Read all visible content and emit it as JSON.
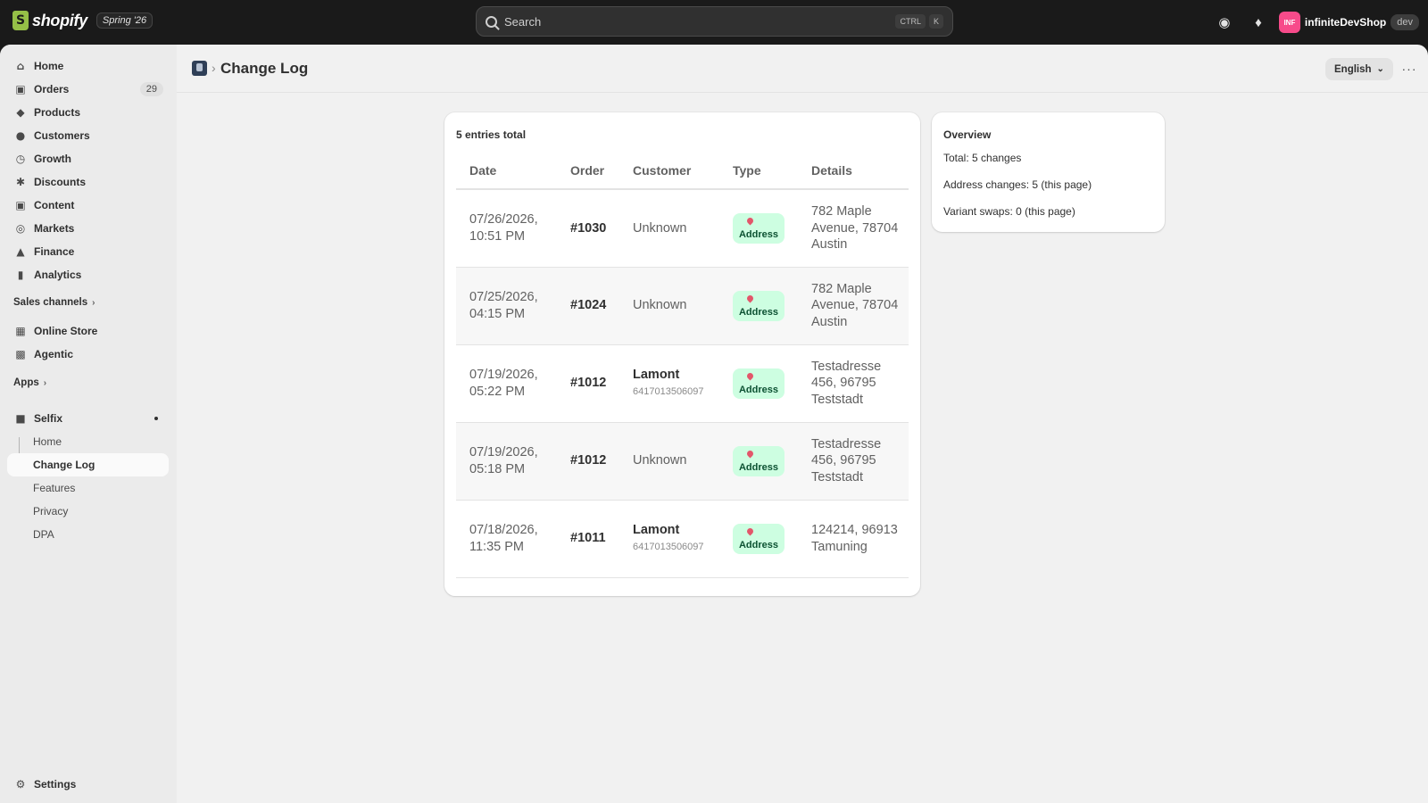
{
  "topbar": {
    "brand": "shopify",
    "tag": "Spring '26",
    "search_placeholder": "Search",
    "shortcut_keys": [
      "CTRL",
      "K"
    ],
    "shop_initials": "INF",
    "shop_name": "infiniteDevShop",
    "shop_badge": "dev"
  },
  "sidebar": {
    "main": [
      {
        "label": "Home",
        "icon": "home-icon"
      },
      {
        "label": "Orders",
        "icon": "orders-icon",
        "badge": "29"
      },
      {
        "label": "Products",
        "icon": "tag-icon"
      },
      {
        "label": "Customers",
        "icon": "person-icon"
      },
      {
        "label": "Growth",
        "icon": "gauge-icon"
      },
      {
        "label": "Discounts",
        "icon": "discount-icon"
      },
      {
        "label": "Content",
        "icon": "monitor-icon"
      },
      {
        "label": "Markets",
        "icon": "globe-icon"
      },
      {
        "label": "Finance",
        "icon": "bank-icon"
      },
      {
        "label": "Analytics",
        "icon": "bar-chart-icon"
      }
    ],
    "sales_channels_label": "Sales channels",
    "channels": [
      {
        "label": "Online Store",
        "icon": "store-icon"
      },
      {
        "label": "Agentic",
        "icon": "agent-icon"
      }
    ],
    "apps_label": "Apps",
    "app_name": "Selfix",
    "app_sub": [
      {
        "label": "Home"
      },
      {
        "label": "Change Log"
      },
      {
        "label": "Features"
      },
      {
        "label": "Privacy"
      },
      {
        "label": "DPA"
      }
    ],
    "settings_label": "Settings"
  },
  "header": {
    "title": "Change Log",
    "language": "English"
  },
  "log": {
    "total_label": "5 entries total",
    "columns": [
      "Date",
      "Order",
      "Customer",
      "Type",
      "Details"
    ],
    "rows": [
      {
        "date": "07/26/2026, 10:51 PM",
        "order": "#1030",
        "customer": "Unknown",
        "customer_id": "",
        "type": "Address",
        "details": "782 Maple Avenue, 78704 Austin"
      },
      {
        "date": "07/25/2026, 04:15 PM",
        "order": "#1024",
        "customer": "Unknown",
        "customer_id": "",
        "type": "Address",
        "details": "782 Maple Avenue, 78704 Austin"
      },
      {
        "date": "07/19/2026, 05:22 PM",
        "order": "#1012",
        "customer": "Lamont",
        "customer_id": "6417013506097",
        "type": "Address",
        "details": "Testadresse 456, 96795 Teststadt"
      },
      {
        "date": "07/19/2026, 05:18 PM",
        "order": "#1012",
        "customer": "Unknown",
        "customer_id": "",
        "type": "Address",
        "details": "Testadresse 456, 96795 Teststadt"
      },
      {
        "date": "07/18/2026, 11:35 PM",
        "order": "#1011",
        "customer": "Lamont",
        "customer_id": "6417013506097",
        "type": "Address",
        "details": "124214, 96913 Tamuning"
      }
    ]
  },
  "overview": {
    "title": "Overview",
    "total": "Total: 5 changes",
    "address": "Address changes: 5 (this page)",
    "variant": "Variant swaps: 0 (this page)"
  },
  "colors": {
    "topbar_bg": "#1a1a1a",
    "badge_bg": "#cdfee1",
    "badge_text": "#0c5132",
    "shop_avatar": "#f74b8a"
  }
}
